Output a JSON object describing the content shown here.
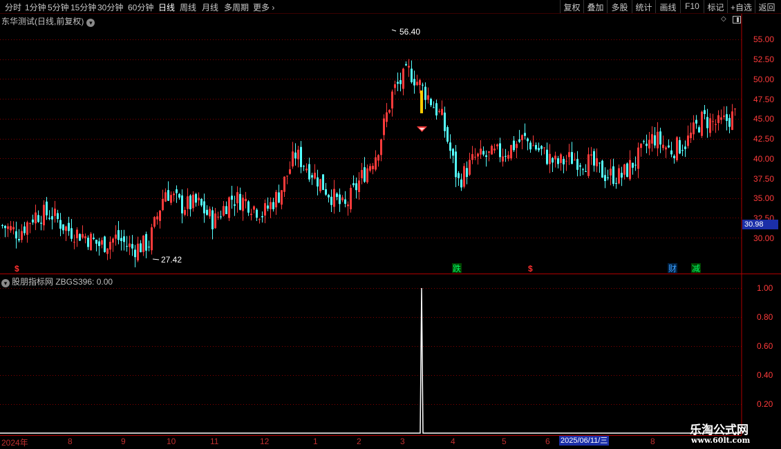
{
  "toolbar": {
    "periods": [
      "分时",
      "1分钟",
      "5分钟",
      "15分钟",
      "30分钟",
      "60分钟",
      "日线",
      "周线",
      "月线",
      "多周期",
      "更多"
    ],
    "active_period": "日线",
    "more_chevron": "chevron-right-icon",
    "right_buttons": [
      "复权",
      "叠加",
      "多股",
      "统计",
      "画线",
      "F10",
      "标记",
      "+自选",
      "返回"
    ]
  },
  "main_title": "东华测试(日线,前复权)",
  "indicator_title": "股朋指标网  ZBGS396: 0.00",
  "price_axis_labels": [
    "55.00",
    "52.50",
    "50.00",
    "47.50",
    "45.00",
    "42.50",
    "40.00",
    "37.50",
    "35.00",
    "32.50",
    "30.00"
  ],
  "indicator_axis_labels": [
    "1.00",
    "0.80",
    "0.60",
    "0.40",
    "0.20"
  ],
  "current_price_tag": "30.98",
  "high_annotation": "56.40",
  "low_annotation": "27.42",
  "event_markers": [
    {
      "text": "$",
      "color": "#ff3030"
    },
    {
      "text": "跌",
      "color": "#00ff66"
    },
    {
      "text": "$",
      "color": "#ff3030"
    },
    {
      "text": "财",
      "color": "#3aa0ff"
    },
    {
      "text": "减",
      "color": "#00ff66"
    }
  ],
  "date_axis_labels": [
    "2024年",
    "8",
    "9",
    "10",
    "11",
    "12",
    "1",
    "2",
    "3",
    "4",
    "5",
    "6",
    "8"
  ],
  "cursor_date": "2025/06/11/三",
  "watermark": {
    "title": "乐淘公式网",
    "url": "www.60lt.com"
  },
  "colors": {
    "up": "#ff3b3b",
    "down": "#54ffff",
    "grid": "#8a0000",
    "axis_text": "#ff3b3b",
    "signal_bar": "#ffcc00",
    "indicator_line": "#ffffff",
    "accent_blue": "#1b2fa8"
  },
  "chart_data": [
    {
      "type": "line",
      "title": "东华测试(日线,前复权)",
      "ylim": [
        27.42,
        56.4
      ],
      "y_ticks": [
        30.0,
        32.5,
        35.0,
        37.5,
        40.0,
        42.5,
        45.0,
        47.5,
        50.0,
        52.5,
        55.0
      ],
      "x": [
        "2024年",
        "8",
        "9",
        "10",
        "11",
        "12",
        "1",
        "2",
        "3",
        "4",
        "5",
        "6",
        "8"
      ],
      "series": [
        {
          "values": [
            31.5,
            30.6,
            32.9,
            33.0,
            31.0,
            30.3,
            29.0,
            30.0,
            28.6,
            29.3,
            36.0,
            34.0,
            34.3,
            32.0,
            35.0,
            34.6,
            33.0,
            35.5,
            40.5,
            38.3,
            35.8,
            33.6,
            37.4,
            40.8,
            48.5,
            51.0,
            48.3,
            45.0,
            37.0,
            40.0,
            40.3,
            41.0,
            42.5,
            41.0,
            39.3,
            40.0,
            39.5,
            38.0,
            37.7,
            40.0,
            42.7,
            41.0,
            42.0,
            45.0,
            44.2,
            45.5
          ]
        }
      ],
      "high": 56.4,
      "low": 27.42,
      "last": 30.98
    },
    {
      "type": "line",
      "title": "股朋指标网  ZBGS396",
      "ylim": [
        0,
        1.0
      ],
      "y_ticks": [
        0.2,
        0.4,
        0.6,
        0.8,
        1.0
      ],
      "series": [
        {
          "name": "ZBGS396",
          "values": [
            0,
            0,
            0,
            0,
            0,
            0,
            0,
            0,
            0,
            0,
            0,
            0,
            0,
            0,
            0,
            0,
            0,
            0,
            0,
            0,
            0,
            0,
            0,
            0,
            0,
            1.0,
            0,
            0,
            0,
            0,
            0,
            0,
            0,
            0,
            0,
            0,
            0,
            0,
            0,
            0,
            0,
            0,
            0,
            0,
            0,
            0
          ]
        }
      ],
      "last": 0.0
    }
  ]
}
